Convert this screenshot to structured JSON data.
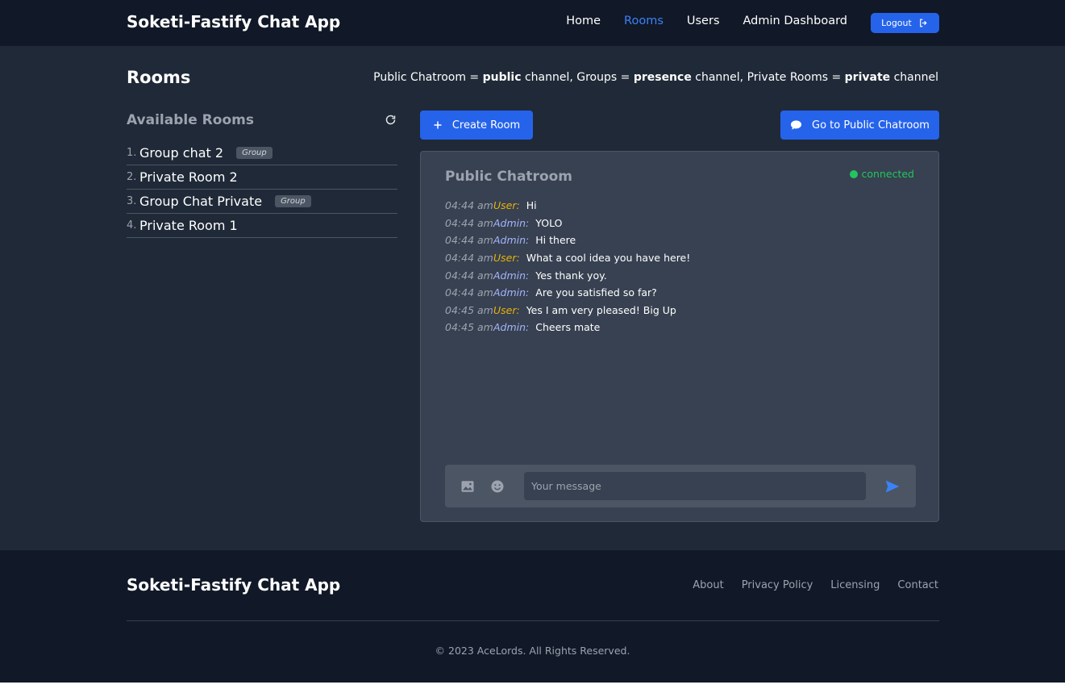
{
  "app": {
    "brand": "Soketi-Fastify Chat App"
  },
  "nav": {
    "links": [
      {
        "label": "Home"
      },
      {
        "label": "Rooms"
      },
      {
        "label": "Users"
      },
      {
        "label": "Admin Dashboard"
      }
    ],
    "active": "Rooms",
    "logout_label": "Logout"
  },
  "page": {
    "title": "Rooms",
    "legend": {
      "p1": "Public Chatroom = ",
      "b1": "public",
      "p2": " channel, Groups = ",
      "b2": "presence",
      "p3": " channel, Private Rooms = ",
      "b3": "private",
      "p4": " channel"
    }
  },
  "rooms": {
    "heading": "Available Rooms",
    "items": [
      {
        "num": "1.",
        "name": "Group chat 2",
        "badge": "Group"
      },
      {
        "num": "2.",
        "name": "Private Room 2",
        "badge": ""
      },
      {
        "num": "3.",
        "name": "Group Chat Private",
        "badge": "Group"
      },
      {
        "num": "4.",
        "name": "Private Room 1",
        "badge": ""
      }
    ]
  },
  "actions": {
    "create_label": "Create Room",
    "public_label": "Go to Public Chatroom"
  },
  "chat": {
    "title": "Public Chatroom",
    "status": "connected",
    "messages": [
      {
        "time": "04:44 am",
        "user": "User:",
        "text": "Hi"
      },
      {
        "time": "04:44 am",
        "user": "Admin:",
        "text": "YOLO"
      },
      {
        "time": "04:44 am",
        "user": "Admin:",
        "text": "Hi there"
      },
      {
        "time": "04:44 am",
        "user": "User:",
        "text": "What a cool idea you have here!"
      },
      {
        "time": "04:44 am",
        "user": "Admin:",
        "text": "Yes thank yoy."
      },
      {
        "time": "04:44 am",
        "user": "Admin:",
        "text": "Are you satisfied so far?"
      },
      {
        "time": "04:45 am",
        "user": "User:",
        "text": "Yes I am very pleased! Big Up"
      },
      {
        "time": "04:45 am",
        "user": "Admin:",
        "text": "Cheers mate"
      }
    ],
    "input_placeholder": "Your message"
  },
  "footer": {
    "brand": "Soketi-Fastify Chat App",
    "links": [
      {
        "label": "About"
      },
      {
        "label": "Privacy Policy"
      },
      {
        "label": "Licensing"
      },
      {
        "label": "Contact"
      }
    ],
    "copyright": "© 2023 AceLords. All Rights Reserved."
  },
  "colors": {
    "accent": "#2563eb",
    "active_link": "#3b82f6",
    "user_name": "#eab308",
    "admin_name": "#a5b4fc",
    "connected": "#22c55e"
  }
}
